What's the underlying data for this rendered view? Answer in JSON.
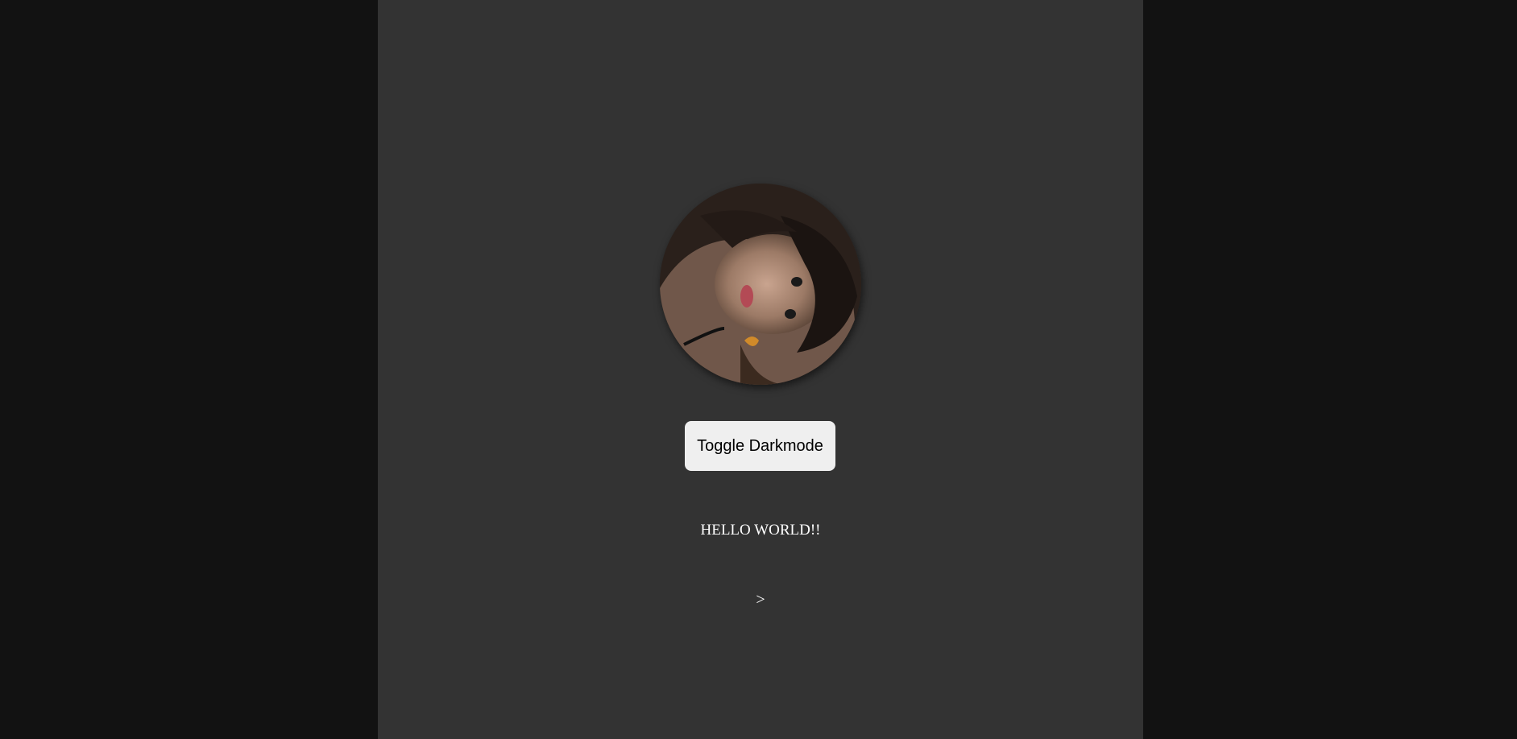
{
  "theme": {
    "outer_background": "#121212",
    "panel_background": "#333333",
    "button_background": "#efefef",
    "text_color": "#ffffff"
  },
  "profile": {
    "avatar_icon": "profile-photo"
  },
  "controls": {
    "toggle_label": "Toggle Darkmode"
  },
  "content": {
    "greeting": "HELLO WORLD!!",
    "next_link": ">"
  }
}
